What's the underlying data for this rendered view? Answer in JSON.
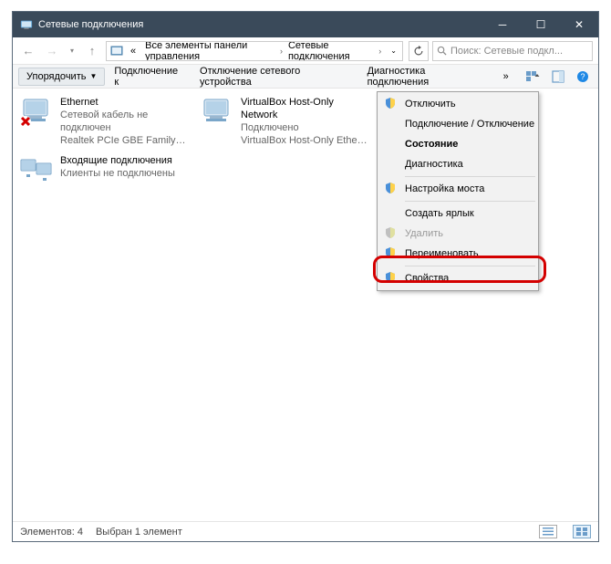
{
  "title": "Сетевые подключения",
  "breadcrumb": {
    "prefix": "«",
    "seg1": "Все элементы панели управления",
    "seg2": "Сетевые подключения"
  },
  "search": {
    "placeholder": "Поиск: Сетевые подкл..."
  },
  "toolbar": {
    "organize": "Упорядочить",
    "connect": "Подключение к",
    "disable": "Отключение сетевого устройства",
    "diag": "Диагностика подключения",
    "overflow": "»"
  },
  "adapters": [
    {
      "name": "Ethernet",
      "status": "Сетевой кабель не подключен",
      "desc": "Realtek PCIe GBE Family Controller",
      "error": true
    },
    {
      "name": "VirtualBox Host-Only Network",
      "status": "Подключено",
      "desc": "VirtualBox Host-Only Ethernet Ad...",
      "error": false
    },
    {
      "name": "Входящие подключения",
      "status": "Клиенты не подключены",
      "desc": "",
      "error": false
    }
  ],
  "context_menu": {
    "disable": "Отключить",
    "connect_disconnect": "Подключение / Отключение",
    "status": "Состояние",
    "diagnostics": "Диагностика",
    "bridge": "Настройка моста",
    "shortcut": "Создать ярлык",
    "delete": "Удалить",
    "rename": "Переименовать",
    "properties": "Свойства"
  },
  "statusbar": {
    "count": "Элементов: 4",
    "selected": "Выбран 1 элемент"
  }
}
